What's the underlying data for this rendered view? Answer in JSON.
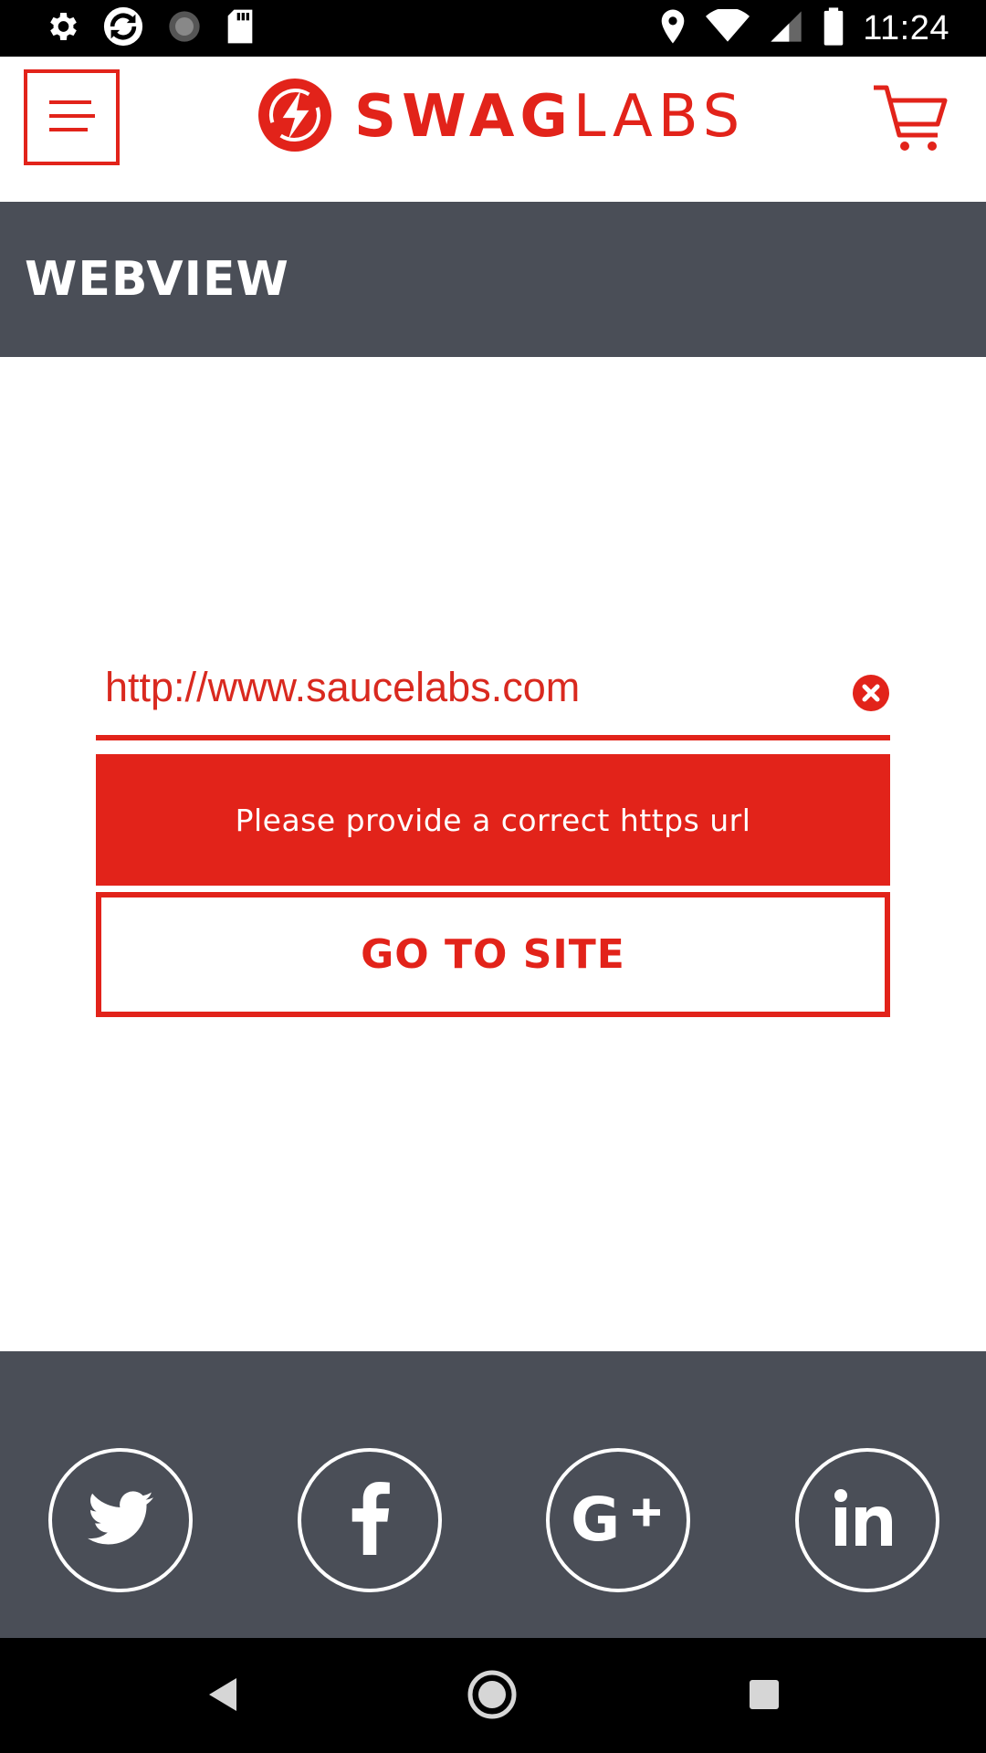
{
  "status_bar": {
    "time": "11:24",
    "left_icons": [
      "gear-icon",
      "sync-icon",
      "loading-icon",
      "sd-card-icon"
    ],
    "right_icons": [
      "location-icon",
      "wifi-icon",
      "signal-icon",
      "battery-icon"
    ]
  },
  "header": {
    "logo_bold": "SWAG",
    "logo_light": "LABS",
    "menu_icon": "menu-icon",
    "cart_icon": "cart-icon"
  },
  "page": {
    "title": "WEBVIEW"
  },
  "form": {
    "url_value": "http://www.saucelabs.com",
    "error_message": "Please provide a correct https url",
    "submit_label": "GO TO SITE"
  },
  "footer": {
    "social": [
      "twitter-icon",
      "facebook-icon",
      "google-plus-icon",
      "linkedin-icon"
    ]
  },
  "nav_bar": {
    "buttons": [
      "back-icon",
      "home-icon",
      "recents-icon"
    ]
  },
  "colors": {
    "brand_red": "#e2231a",
    "dark_gray": "#4a4e57",
    "white": "#ffffff",
    "black": "#000000"
  }
}
